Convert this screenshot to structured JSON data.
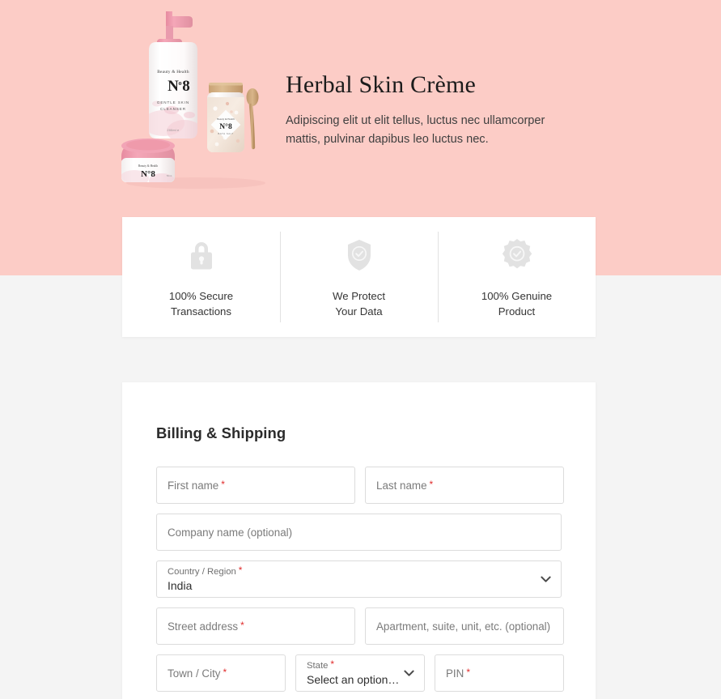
{
  "hero": {
    "title": "Herbal Skin Crème",
    "subtitle": "Adipiscing elit ut elit tellus, luctus nec ullamcorper mattis, pulvinar dapibus leo luctus nec.",
    "background_color": "#fcccc6",
    "product": {
      "brand_line": "Beauty & Health",
      "number": "N°8",
      "descriptor_line_1": "GENTLE SKIN",
      "descriptor_line_2": "CLEANSER",
      "volume": "200ml e",
      "jar_label": "N°8",
      "bottle_cap_color": "#ef9aab"
    }
  },
  "trust": {
    "items": [
      {
        "icon": "padlock-icon",
        "line1": "100% Secure",
        "line2": "Transactions"
      },
      {
        "icon": "shield-check-icon",
        "line1": "We Protect",
        "line2": "Your Data"
      },
      {
        "icon": "badge-check-icon",
        "line1": "100% Genuine",
        "line2": "Product"
      }
    ]
  },
  "billing": {
    "heading": "Billing & Shipping",
    "required_marker": "*",
    "fields": {
      "first_name": {
        "label": "First name",
        "required": true,
        "value": ""
      },
      "last_name": {
        "label": "Last name",
        "required": true,
        "value": ""
      },
      "company_name": {
        "label": "Company name (optional)",
        "required": false,
        "value": ""
      },
      "country": {
        "label": "Country / Region",
        "required": true,
        "value": "India"
      },
      "street": {
        "label": "Street address",
        "required": true,
        "value": ""
      },
      "apartment": {
        "label": "Apartment, suite, unit, etc. (optional)",
        "required": false,
        "value": ""
      },
      "town": {
        "label": "Town / City",
        "required": true,
        "value": ""
      },
      "state": {
        "label": "State",
        "required": true,
        "value": "Select an option…"
      },
      "pin": {
        "label": "PIN",
        "required": true,
        "value": ""
      }
    }
  },
  "colors": {
    "hero_pink": "#fcccc6",
    "page_bg": "#f4f4f4",
    "card_bg": "#ffffff",
    "border": "#dcdcdc",
    "required_red": "#e02b2b",
    "icon_gray": "#e0e0e0"
  }
}
